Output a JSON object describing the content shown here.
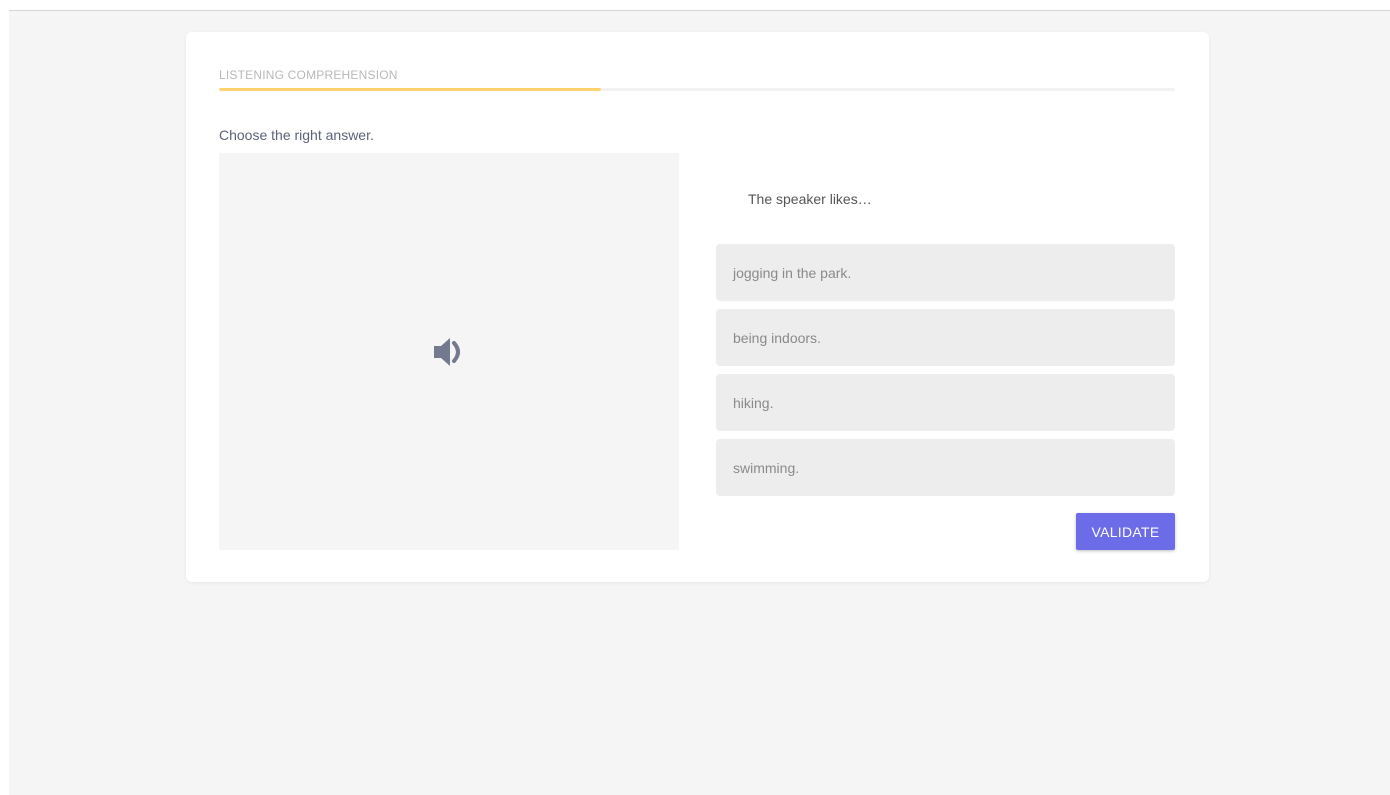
{
  "exercise": {
    "section_title": "LISTENING COMPREHENSION",
    "progress_percent": 40,
    "progress_color": "#ffd36e",
    "instruction": "Choose the right answer.",
    "media": {
      "icon": "speaker-volume-icon"
    },
    "question": "The speaker likes…",
    "options": [
      {
        "label": "jogging in the park."
      },
      {
        "label": "being indoors."
      },
      {
        "label": "hiking."
      },
      {
        "label": "swimming."
      }
    ],
    "validate_label": "VALIDATE",
    "accent_color": "#6c6be8"
  }
}
